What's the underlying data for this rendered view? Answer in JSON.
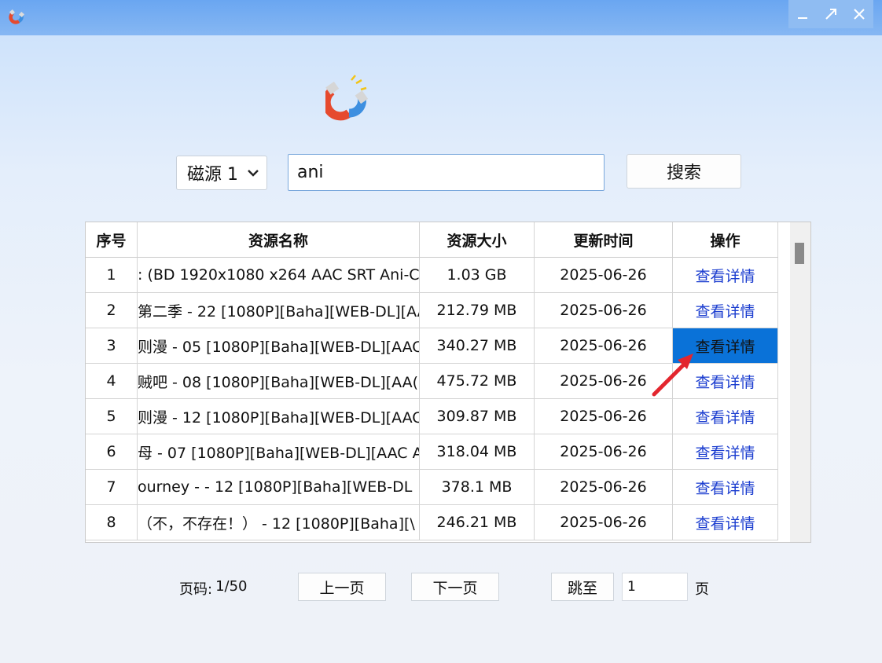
{
  "window": {
    "controls": [
      "minimize",
      "maximize",
      "close"
    ]
  },
  "search": {
    "source_selected": "磁源 1",
    "query": "ani",
    "button_label": "搜索"
  },
  "table": {
    "columns": [
      "序号",
      "资源名称",
      "资源大小",
      "更新时间",
      "操作"
    ],
    "rows": [
      {
        "index": "1",
        "name": ": (BD 1920x1080 x264 AAC SRT Ani-C",
        "size": "1.03 GB",
        "time": "2025-06-26",
        "action": "查看详情"
      },
      {
        "index": "2",
        "name": "第二季 - 22 [1080P][Baha][WEB-DL][AA",
        "size": "212.79 MB",
        "time": "2025-06-26",
        "action": "查看详情"
      },
      {
        "index": "3",
        "name": "则漫 - 05 [1080P][Baha][WEB-DL][AAC",
        "size": "340.27 MB",
        "time": "2025-06-26",
        "action": "查看详情"
      },
      {
        "index": "4",
        "name": "贼吧 - 08 [1080P][Baha][WEB-DL][AA(",
        "size": "475.72 MB",
        "time": "2025-06-26",
        "action": "查看详情"
      },
      {
        "index": "5",
        "name": "则漫 - 12 [1080P][Baha][WEB-DL][AAC",
        "size": "309.87 MB",
        "time": "2025-06-26",
        "action": "查看详情"
      },
      {
        "index": "6",
        "name": "母 - 07 [1080P][Baha][WEB-DL][AAC A",
        "size": "318.04 MB",
        "time": "2025-06-26",
        "action": "查看详情"
      },
      {
        "index": "7",
        "name": "ourney -  - 12 [1080P][Baha][WEB-DL",
        "size": "378.1 MB",
        "time": "2025-06-26",
        "action": "查看详情"
      },
      {
        "index": "8",
        "name": "（不，不存在！） - 12 [1080P][Baha][\\",
        "size": "246.21 MB",
        "time": "2025-06-26",
        "action": "查看详情"
      }
    ],
    "selected_row_index": "3"
  },
  "pagination": {
    "label": "页码:",
    "current": "1/50",
    "prev_label": "上一页",
    "next_label": "下一页",
    "jump_label": "跳至",
    "page_input_value": "1",
    "page_unit": "页"
  },
  "colors": {
    "titlebar": "#6aa6f1",
    "selected_cell": "#0a72d8",
    "action_link": "#1a3ccf",
    "annotation_arrow": "#e3262e"
  },
  "icons": {
    "app": "magnet-icon",
    "arrow": "red-annotation-arrow"
  }
}
